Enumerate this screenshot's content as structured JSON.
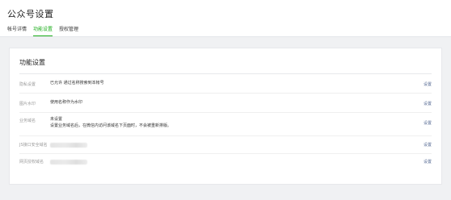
{
  "header": {
    "title": "公众号设置",
    "tabs": [
      {
        "label": "帐号详情",
        "active": false
      },
      {
        "label": "功能设置",
        "active": true
      },
      {
        "label": "授权管理",
        "active": false
      }
    ]
  },
  "section": {
    "title": "功能设置",
    "rows": [
      {
        "label": "隐私设置",
        "value": "已允许 通过名称搜索到本帐号",
        "action": "设置"
      },
      {
        "label": "图片水印",
        "value": "使用名称作为水印",
        "action": "设置"
      },
      {
        "label": "业务域名",
        "value": "未设置",
        "value2": "设置业务域名后，在微信内访问该域名下页面时，不会被重新排版。",
        "action": "设置"
      },
      {
        "label": "JS接口安全域名",
        "value": "",
        "action": "设置"
      },
      {
        "label": "网页授权域名",
        "value": "",
        "action": "设置"
      }
    ]
  },
  "colors": {
    "accent_green": "#1aad19",
    "link_blue": "#576b95",
    "background": "#f0f1f3"
  }
}
